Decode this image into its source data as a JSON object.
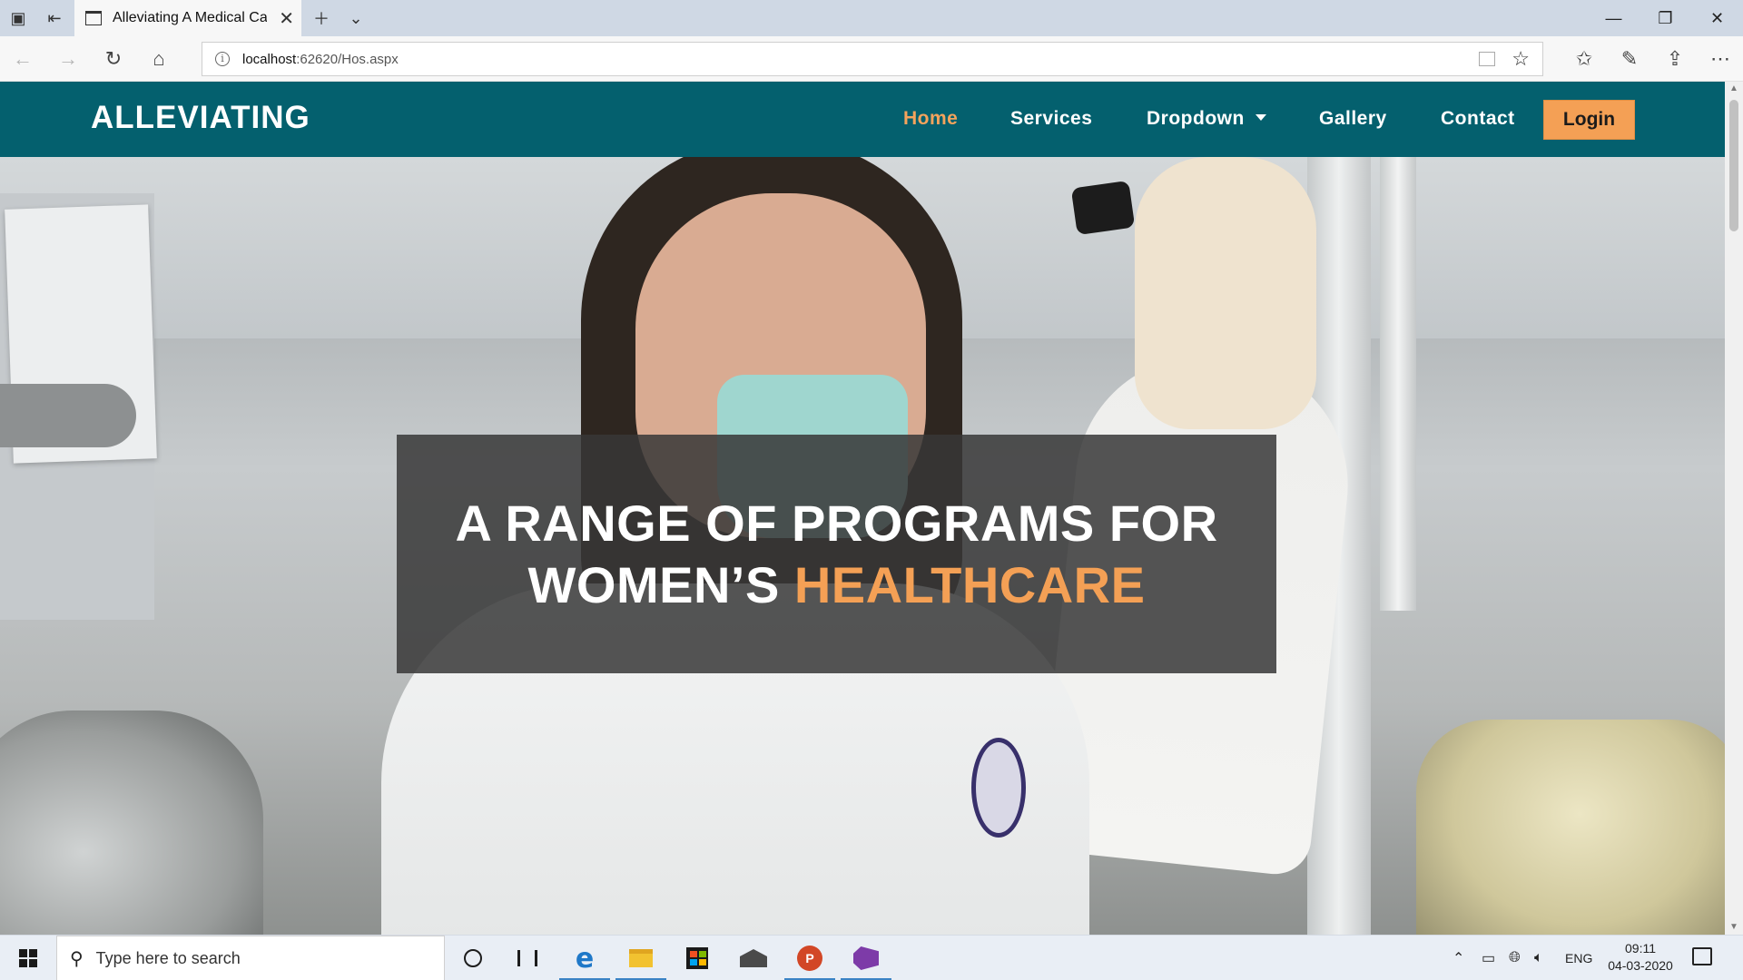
{
  "browser": {
    "tab_title": "Alleviating A Medical Ca",
    "url_host": "localhost",
    "url_rest": ":62620/Hos.aspx"
  },
  "site": {
    "brand": "ALLEVIATING",
    "nav": {
      "home": "Home",
      "services": "Services",
      "dropdown": "Dropdown",
      "gallery": "Gallery",
      "contact": "Contact",
      "login": "Login"
    },
    "hero": {
      "line1": "A RANGE OF PROGRAMS FOR",
      "line2_plain": "WOMEN’S ",
      "line2_accent": "HEALTHCARE"
    },
    "colors": {
      "header_bg": "#04606e",
      "accent": "#f4a055"
    }
  },
  "taskbar": {
    "search_placeholder": "Type here to search",
    "language": "ENG",
    "time": "09:11",
    "date": "04-03-2020"
  },
  "icons": {
    "tabs_aside": "tabs-aside-icon",
    "back": "back-arrow-icon",
    "forward": "forward-arrow-icon",
    "refresh": "refresh-icon",
    "home": "home-icon",
    "favorites": "favorites-icon",
    "notes": "pen-icon",
    "share": "share-icon",
    "more": "more-icon"
  }
}
